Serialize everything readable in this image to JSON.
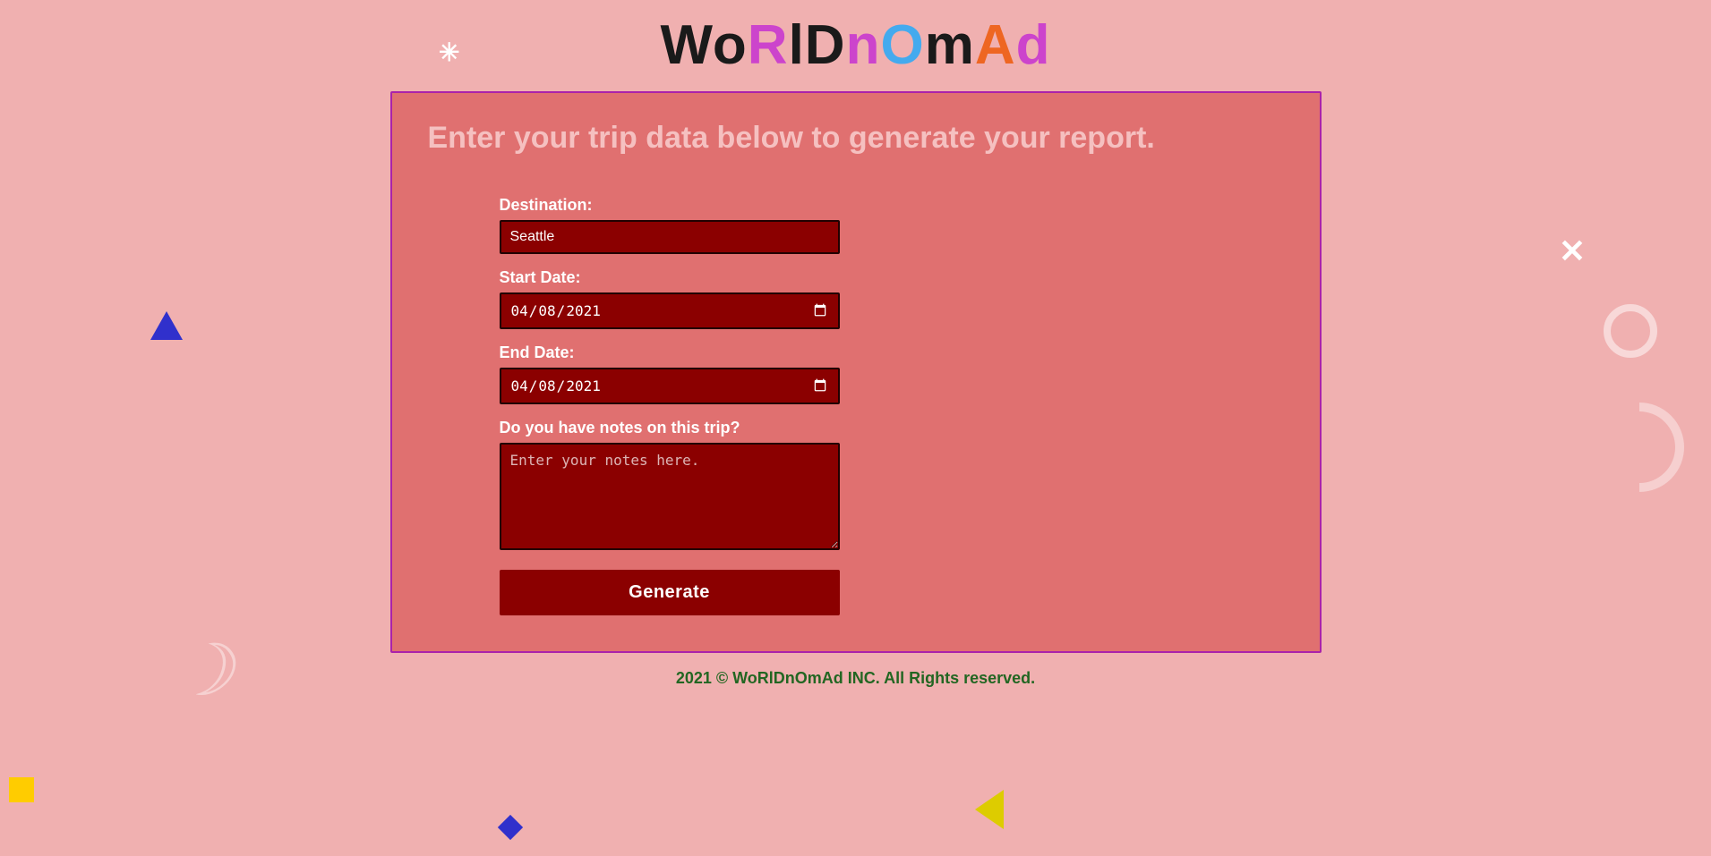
{
  "app": {
    "title_parts": [
      {
        "char": "W",
        "class": "logo-W"
      },
      {
        "char": "o",
        "class": "logo-o"
      },
      {
        "char": "R",
        "class": "logo-R"
      },
      {
        "char": "l",
        "class": "logo-l"
      },
      {
        "char": "D",
        "class": "logo-D"
      },
      {
        "char": "n",
        "class": "logo-n"
      },
      {
        "char": "O",
        "class": "logo-O"
      },
      {
        "char": "m",
        "class": "logo-m"
      },
      {
        "char": "A",
        "class": "logo-A"
      },
      {
        "char": "d",
        "class": "logo-d"
      }
    ]
  },
  "form": {
    "heading": "Enter your trip data below to generate your report.",
    "destination_label": "Destination:",
    "destination_value": "Seattle",
    "destination_placeholder": "Seattle",
    "start_date_label": "Start Date:",
    "start_date_value": "2021-04-08",
    "end_date_label": "End Date:",
    "end_date_value": "2021-04-08",
    "notes_label": "Do you have notes on this trip?",
    "notes_placeholder": "Enter your notes here.",
    "generate_label": "Generate"
  },
  "footer": {
    "text": "2021 © WoRlDnOmAd INC. All Rights reserved."
  },
  "decorations": {
    "asterisk": "*",
    "x_mark": "✕",
    "spiral": "ℂ"
  }
}
